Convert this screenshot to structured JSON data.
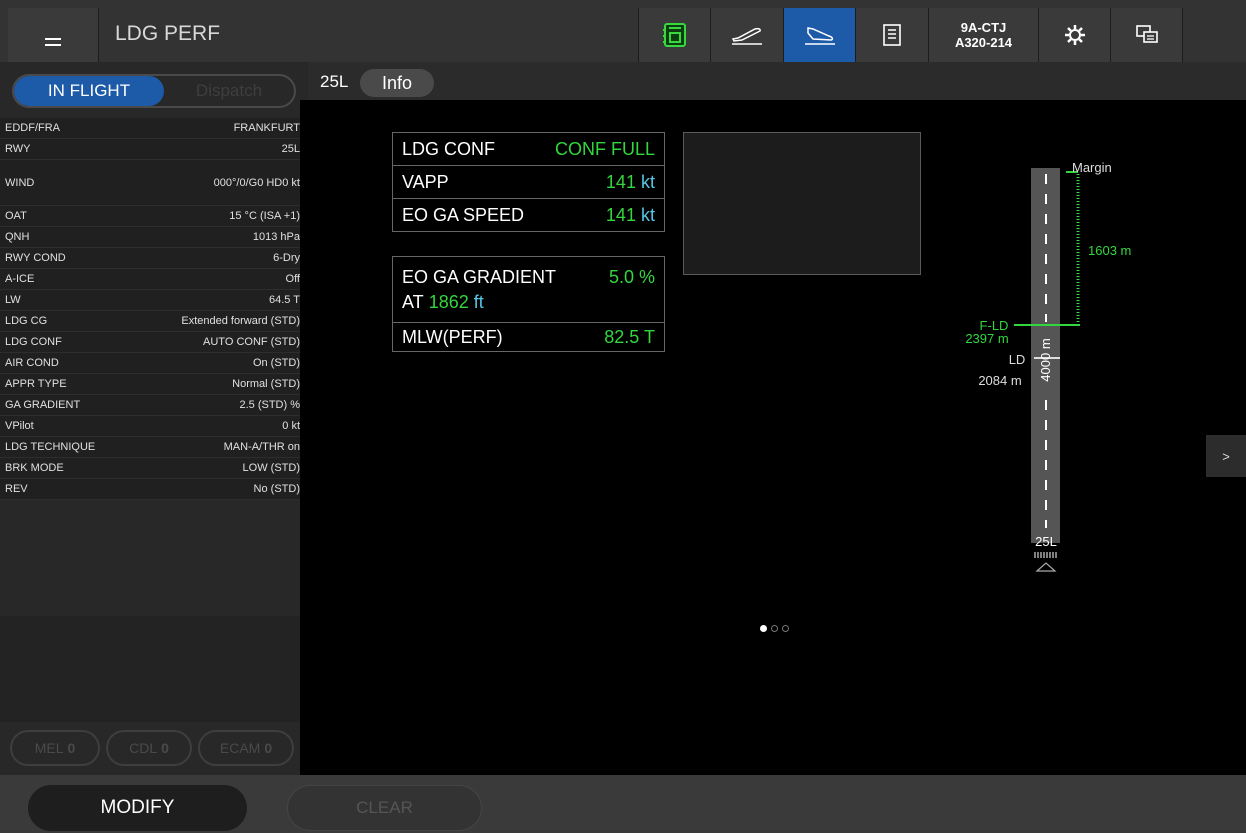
{
  "header": {
    "title": "LDG PERF",
    "aircraft_reg": "9A-CTJ",
    "aircraft_type": "A320-214",
    "accent_color": "#1d5aa8",
    "icons": [
      "ofp-icon",
      "takeoff-icon",
      "landing-icon",
      "document-icon",
      "gear-icon",
      "chat-icon"
    ]
  },
  "mode": {
    "inflight_label": "IN FLIGHT",
    "dispatch_label": "Dispatch"
  },
  "params": [
    {
      "label": "EDDF/FRA",
      "value": "FRANKFURT"
    },
    {
      "label": "RWY",
      "value": "25L"
    },
    {
      "label": "WIND",
      "value": "000°/0/G0 HD0 kt"
    },
    {
      "label": "OAT",
      "value": "15 °C (ISA +1)"
    },
    {
      "label": "QNH",
      "value": "1013 hPa"
    },
    {
      "label": "RWY COND",
      "value": "6-Dry"
    },
    {
      "label": "A-ICE",
      "value": "Off"
    },
    {
      "label": "LW",
      "value": "64.5 T"
    },
    {
      "label": "LDG CG",
      "value": "Extended forward (STD)"
    },
    {
      "label": "LDG CONF",
      "value": "AUTO CONF (STD)"
    },
    {
      "label": "AIR COND",
      "value": "On (STD)"
    },
    {
      "label": "APPR TYPE",
      "value": "Normal (STD)"
    },
    {
      "label": "GA GRADIENT",
      "value": "2.5 (STD) %"
    },
    {
      "label": "VPilot",
      "value": "0 kt"
    },
    {
      "label": "LDG TECHNIQUE",
      "value": "MAN-A/THR on"
    },
    {
      "label": "BRK MODE",
      "value": "LOW (STD)"
    },
    {
      "label": "REV",
      "value": "No (STD)"
    }
  ],
  "pills": {
    "mel_label": "MEL",
    "mel_count": "0",
    "cdl_label": "CDL",
    "cdl_count": "0",
    "ecam_label": "ECAM",
    "ecam_count": "0"
  },
  "tabs": {
    "rwy": "25L",
    "info": "Info"
  },
  "results": {
    "ldg_conf_label": "LDG CONF",
    "ldg_conf_value": "CONF FULL",
    "vapp_label": "VAPP",
    "vapp_value": "141",
    "vapp_unit": "kt",
    "eo_ga_speed_label": "EO GA SPEED",
    "eo_ga_speed_value": "141",
    "eo_ga_speed_unit": "kt",
    "eo_ga_gradient_label": "EO GA GRADIENT",
    "eo_ga_gradient_value": "5.0 %",
    "at_label": "AT",
    "at_value": "1862",
    "at_unit": "ft",
    "mlw_label": "MLW(PERF)",
    "mlw_value": "82.5 T"
  },
  "runway": {
    "margin_label": "Margin",
    "margin_value": "1603 m",
    "fld_label": "F-LD",
    "fld_value": "2397 m",
    "ld_label": "LD",
    "ld_value": "2084 m",
    "length_label": "4000 m",
    "rwy_label": "25L"
  },
  "nav": {
    "next_label": ">",
    "page_count": 3,
    "current_page": 1
  },
  "footer": {
    "modify_label": "MODIFY",
    "clear_label": "CLEAR"
  }
}
